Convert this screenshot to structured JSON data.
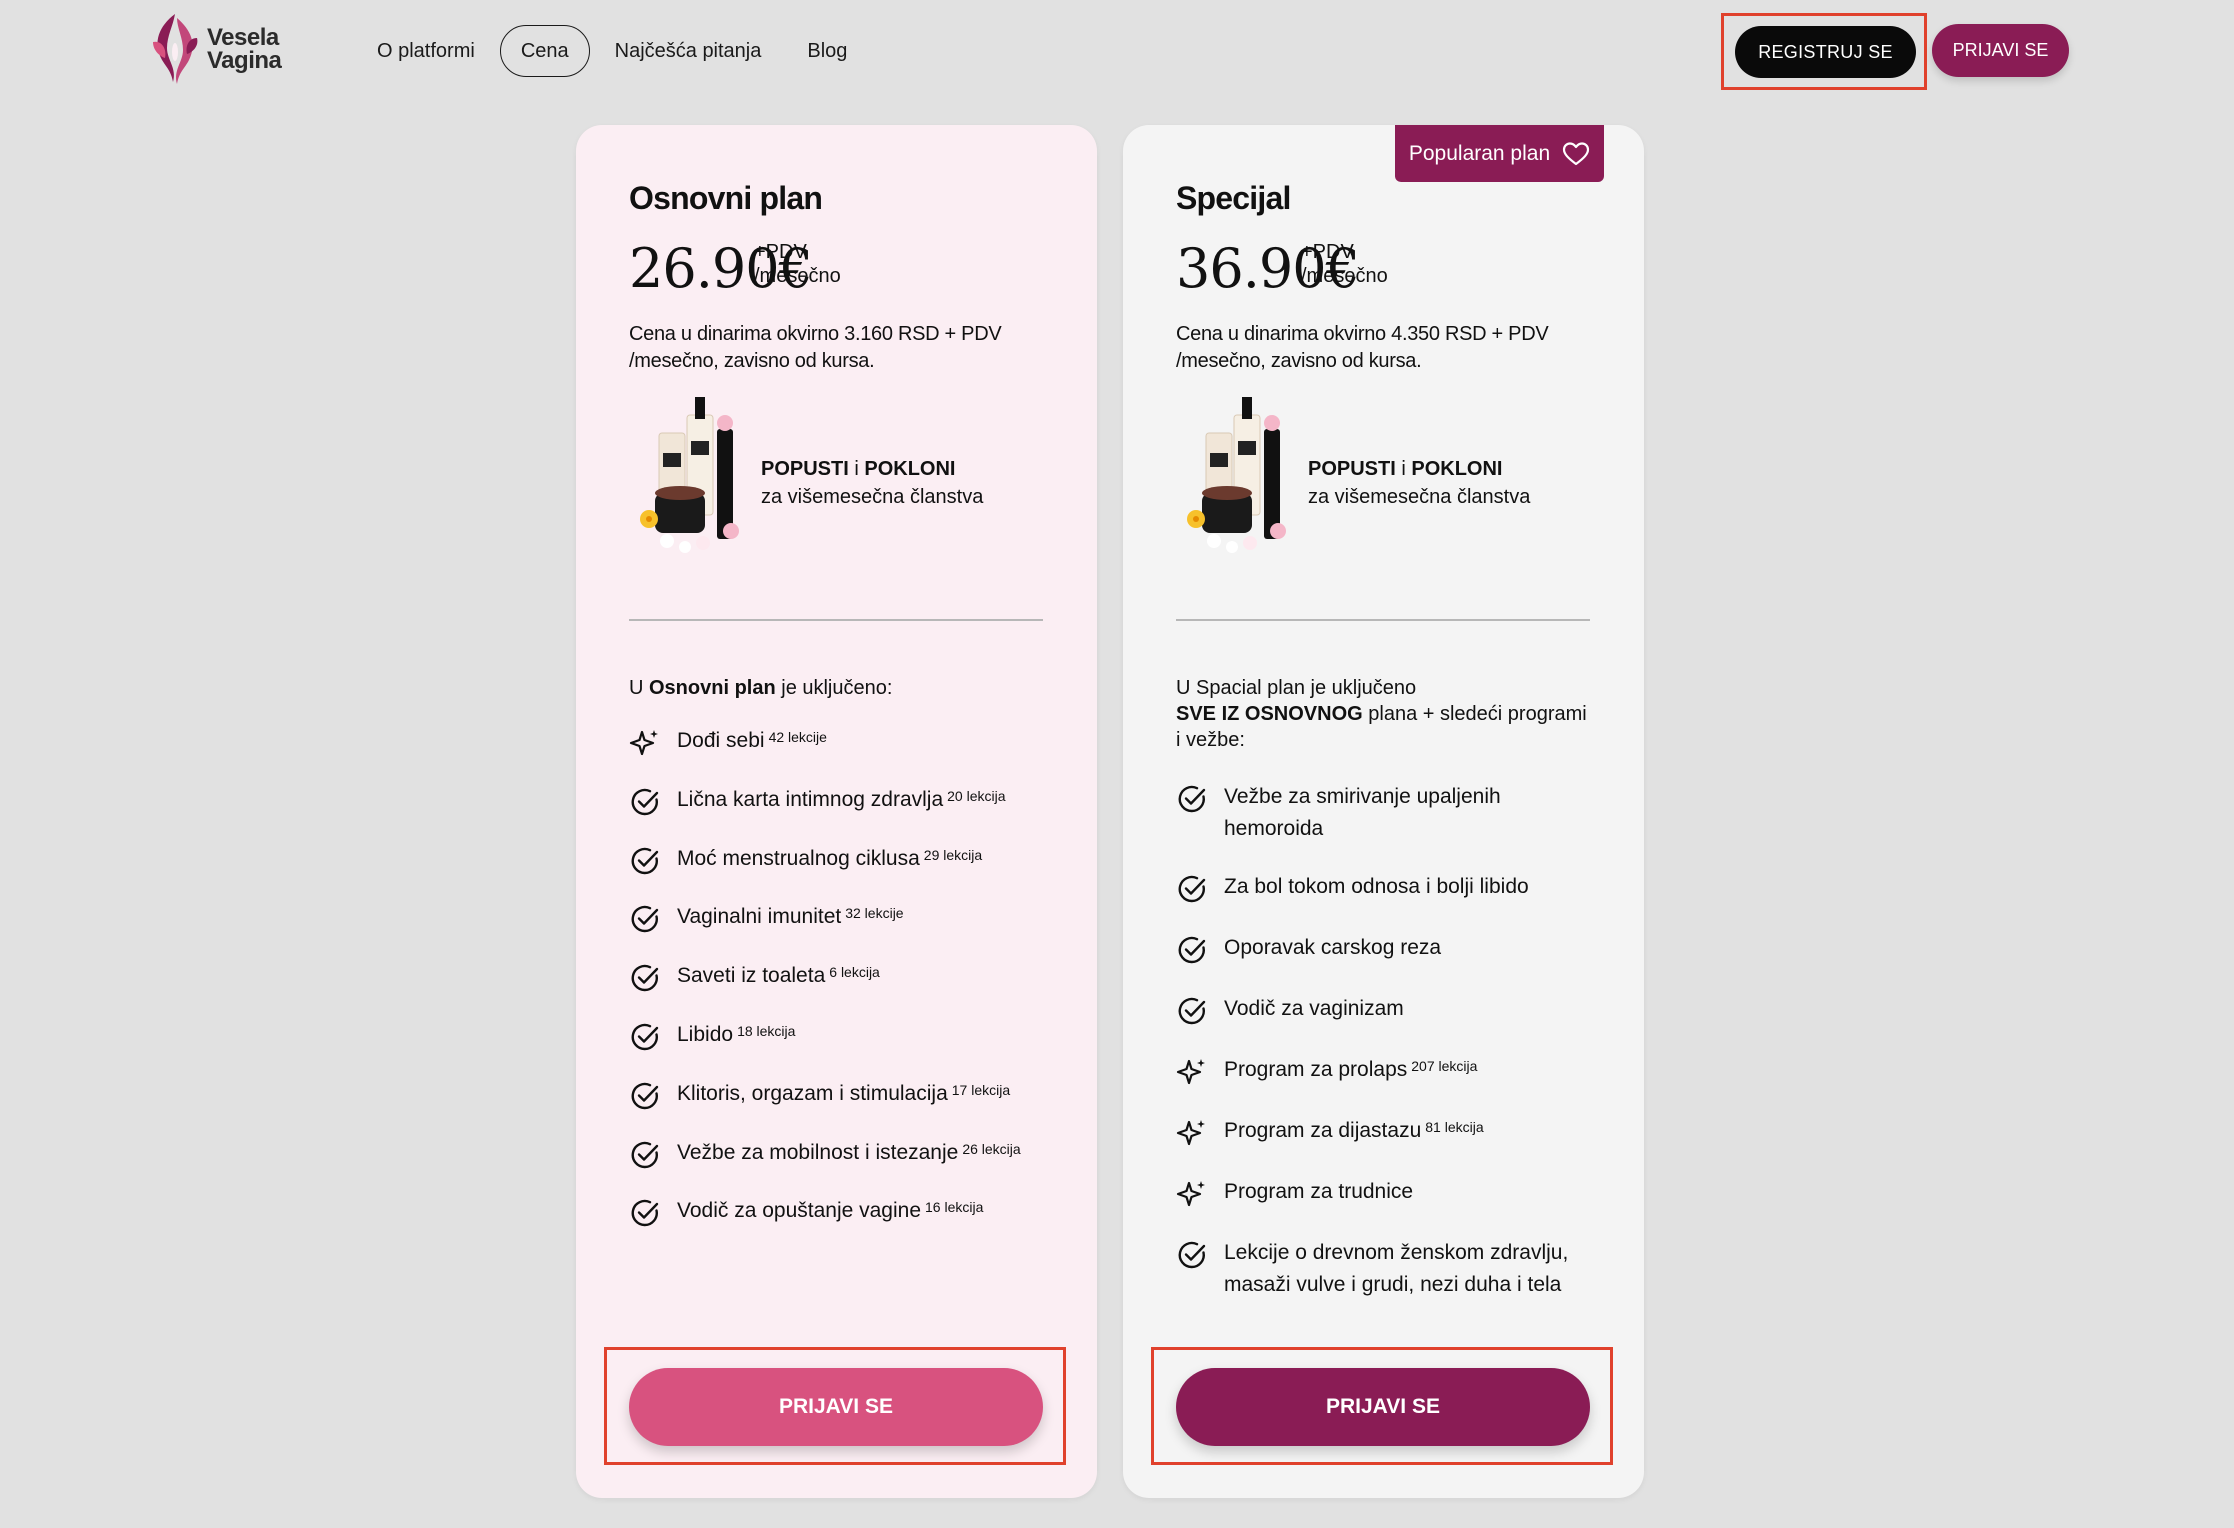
{
  "brand": {
    "line1": "Vesela",
    "line2": "Vagina",
    "color": "#8a1c55"
  },
  "nav": {
    "items": [
      {
        "label": "O platformi",
        "active": false
      },
      {
        "label": "Cena",
        "active": true
      },
      {
        "label": "Najčešća pitanja",
        "active": false
      },
      {
        "label": "Blog",
        "active": false
      }
    ]
  },
  "header": {
    "register_label": "REGISTRUJ SE",
    "login_label": "PRIJAVI SE"
  },
  "plans": {
    "basic": {
      "title": "Osnovni plan",
      "price": "26.90€",
      "vat": "+PDV",
      "period": "/mesečno",
      "price_desc": "Cena u dinarima okvirno 3.160 RSD + PDV /mesečno, zavisno od kursa.",
      "promo_bold1": "POPUSTI",
      "promo_mid": " i ",
      "promo_bold2": "POKLONI",
      "promo_line2": "za višemesečna članstva",
      "included_pre": "U ",
      "included_bold": "Osnovni plan",
      "included_post": " je uključeno:",
      "features": [
        {
          "icon": "sparkle-icon",
          "text": "Dođi sebi",
          "count": "42 lekcije"
        },
        {
          "icon": "check-circle-icon",
          "text": "Lična karta intimnog zdravlja",
          "count": "20 lekcija"
        },
        {
          "icon": "check-circle-icon",
          "text": "Moć menstrualnog ciklusa",
          "count": "29 lekcija"
        },
        {
          "icon": "check-circle-icon",
          "text": "Vaginalni imunitet",
          "count": "32 lekcije"
        },
        {
          "icon": "check-circle-icon",
          "text": "Saveti iz toaleta",
          "count": "6 lekcija"
        },
        {
          "icon": "check-circle-icon",
          "text": "Libido",
          "count": "18 lekcija"
        },
        {
          "icon": "check-circle-icon",
          "text": "Klitoris, orgazam i stimulacija",
          "count": "17 lekcija"
        },
        {
          "icon": "check-circle-icon",
          "text": "Vežbe za mobilnost i istezanje",
          "count": "26 lekcija"
        },
        {
          "icon": "check-circle-icon",
          "text": "Vodič za opuštanje vagine",
          "count": "16 lekcija"
        }
      ],
      "cta_label": "PRIJAVI SE",
      "cta_color": "#d8527f"
    },
    "special": {
      "badge": "Popularan plan",
      "title": "Specijal",
      "price": "36.90€",
      "vat": "+PDV",
      "period": "/mesečno",
      "price_desc": "Cena u dinarima okvirno 4.350 RSD + PDV /mesečno, zavisno od kursa.",
      "promo_bold1": "POPUSTI",
      "promo_mid": " i ",
      "promo_bold2": "POKLONI",
      "promo_line2": "za višemesečna članstva",
      "included_line1": "U Spacial plan je uključeno",
      "included_bold": "SVE IZ OSNOVNOG",
      "included_post": " plana + sledeći programi i vežbe:",
      "features": [
        {
          "icon": "check-circle-icon",
          "text": "Vežbe za smirivanje upaljenih hemoroida",
          "count": ""
        },
        {
          "icon": "check-circle-icon",
          "text": "Za bol tokom odnosa i bolji libido",
          "count": ""
        },
        {
          "icon": "check-circle-icon",
          "text": "Oporavak carskog reza",
          "count": ""
        },
        {
          "icon": "check-circle-icon",
          "text": "Vodič za vaginizam",
          "count": ""
        },
        {
          "icon": "sparkle-icon",
          "text": "Program za prolaps",
          "count": "207 lekcija"
        },
        {
          "icon": "sparkle-icon",
          "text": "Program za dijastazu",
          "count": "81 lekcija"
        },
        {
          "icon": "sparkle-icon",
          "text": "Program za trudnice",
          "count": ""
        },
        {
          "icon": "check-circle-icon",
          "text": "Lekcije o drevnom ženskom zdravlju, masaži vulve i grudi, nezi duha i tela",
          "count": ""
        }
      ],
      "cta_label": "PRIJAVI SE",
      "cta_color": "#8a1c55"
    }
  },
  "colors": {
    "accent": "#8a1c55",
    "pink": "#d8527f",
    "highlight_frame": "#e0412c"
  }
}
